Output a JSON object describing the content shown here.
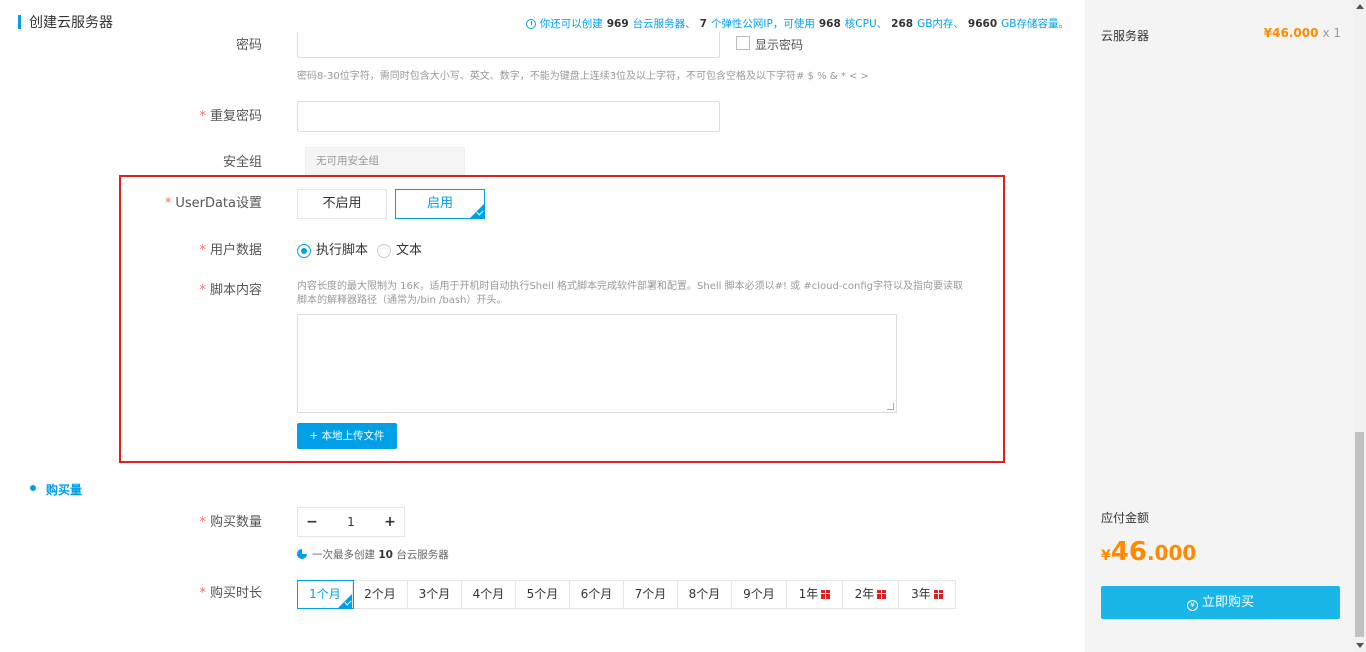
{
  "header": {
    "title": "创建云服务器",
    "quota": {
      "prefix": "你还可以创建",
      "servers": "969",
      "servers_unit": "台云服务器、",
      "ips": "7",
      "ips_unit": "个弹性公网IP，可使用",
      "cpu": "968",
      "cpu_unit": "核CPU、",
      "memory": "268",
      "memory_unit": "GB内存、",
      "storage": "9660",
      "storage_unit": "GB存储容量。"
    }
  },
  "form": {
    "password": {
      "label": "密码",
      "show_password_label": "显示密码",
      "hint": "密码8-30位字符，需同时包含大小写、英文、数字，不能为键盘上连续3位及以上字符，不可包含空格及以下字符# $ % & * < >"
    },
    "repeat_password": {
      "label": "重复密码",
      "value": ""
    },
    "security_group": {
      "label": "安全组",
      "value": "无可用安全组"
    },
    "userdata": {
      "label": "UserData设置",
      "options": [
        "不启用",
        "启用"
      ],
      "selected": "启用"
    },
    "user_data_type": {
      "label": "用户数据",
      "options": [
        "执行脚本",
        "文本"
      ],
      "selected": "执行脚本"
    },
    "script": {
      "label": "脚本内容",
      "hint_line1": "内容长度的最大限制为 16K，适用于开机时自动执行Shell 格式脚本完成软件部署和配置。Shell 脚本必须以#! 或 #cloud-config字符以及指向要读取",
      "hint_line2": "脚本的解释器路径（通常为/bin /bash）开头。",
      "value": "",
      "upload_label": "+ 本地上传文件"
    }
  },
  "purchase": {
    "section_title": "购买量",
    "quantity": {
      "label": "购买数量",
      "minus": "−",
      "plus": "+",
      "value": "1",
      "note_prefix": "一次最多创建",
      "note_max": "10",
      "note_suffix": "台云服务器"
    },
    "duration": {
      "label": "购买时长",
      "options": [
        "1个月",
        "2个月",
        "3个月",
        "4个月",
        "5个月",
        "6个月",
        "7个月",
        "8个月",
        "9个月",
        "1年",
        "2年",
        "3年"
      ],
      "selected": "1个月"
    }
  },
  "sidebar": {
    "item_name": "云服务器",
    "item_price": "¥46.000",
    "item_qty": "x 1",
    "pay_label": "应付金额",
    "pay_currency": "¥",
    "pay_int": "46",
    "pay_dec": ".000",
    "buy_label": "立即购买"
  },
  "colors": {
    "accent": "#00a0e9",
    "price": "#ff8a00",
    "required": "#f56c6c",
    "highlight_border": "#e02020"
  }
}
